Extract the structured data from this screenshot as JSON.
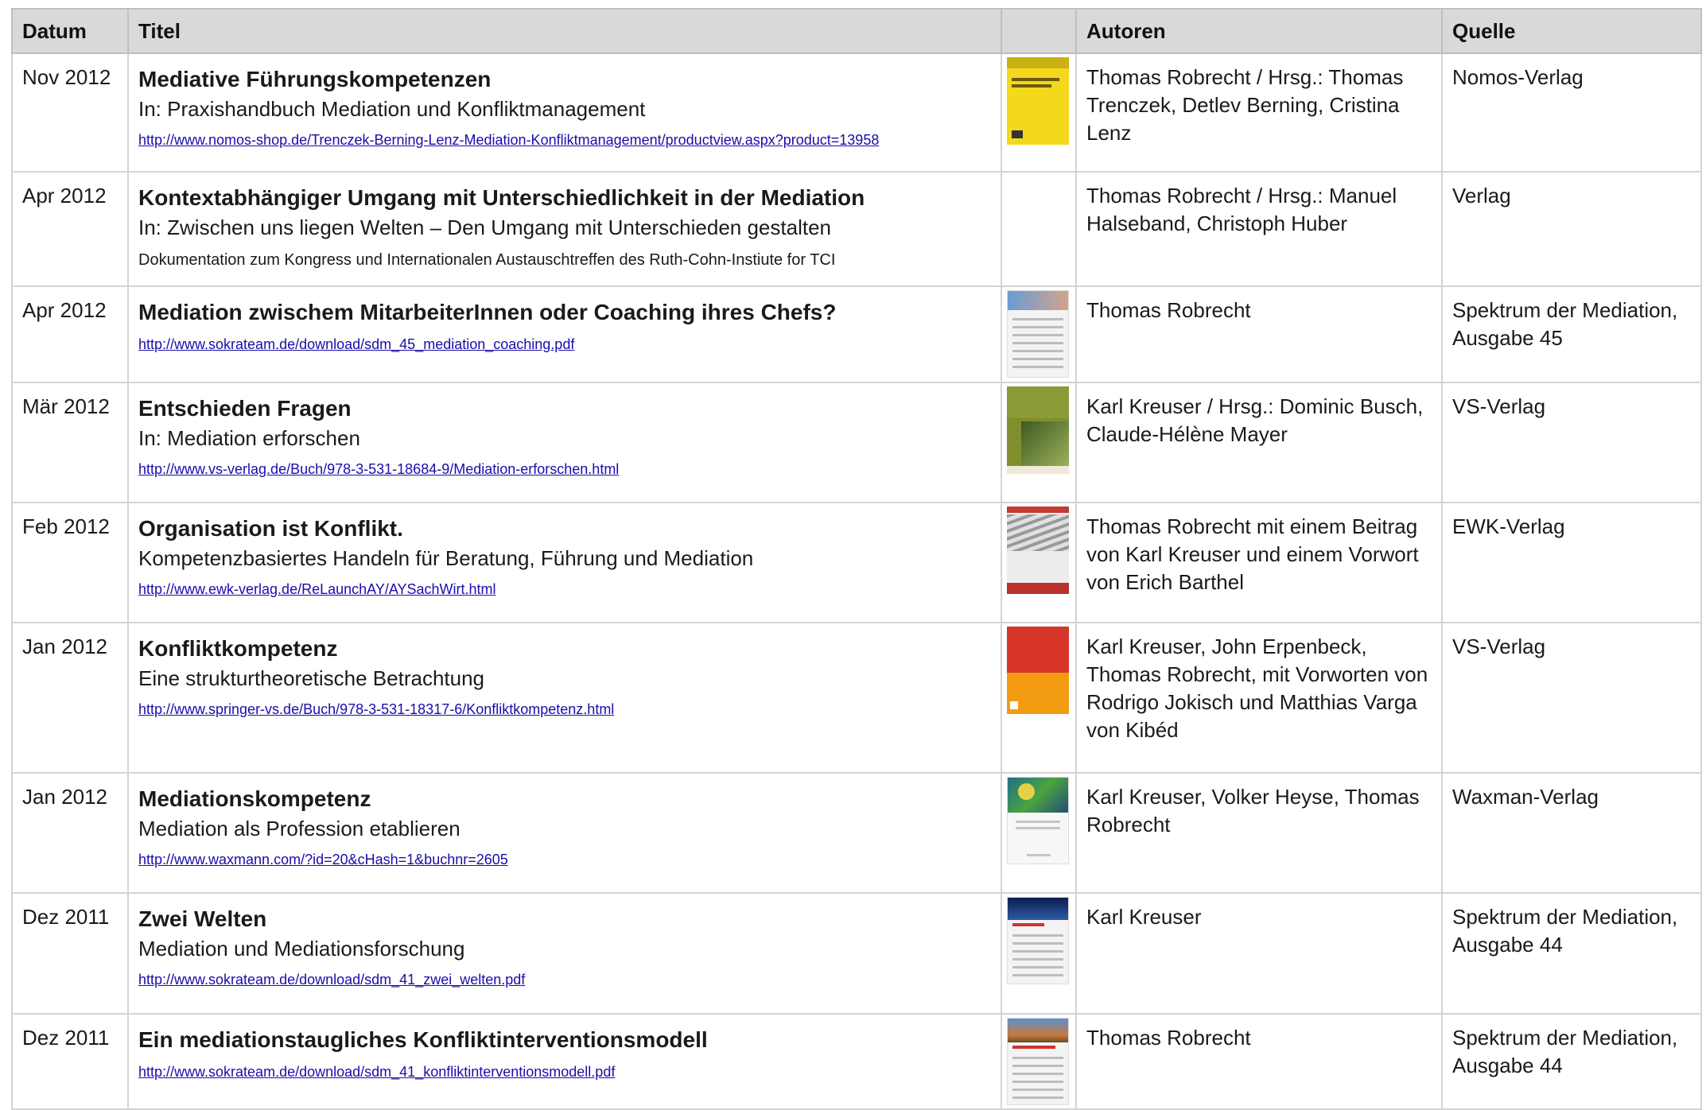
{
  "header": {
    "datum": "Datum",
    "titel": "Titel",
    "autoren": "Autoren",
    "quelle": "Quelle"
  },
  "rows": [
    {
      "date": "Nov 2012",
      "title": "Mediative Führungskompetenzen",
      "subtitle": "In: Praxishandbuch Mediation und Konfliktmanagement",
      "link": "http://www.nomos-shop.de/Trenczek-Berning-Lenz-Mediation-Konfliktmanagement/productview.aspx?product=13958",
      "note": "",
      "cover": "yellow-book-cover",
      "authors": "Thomas Robrecht /  Hrsg.: Thomas Trenczek, Detlev Berning,  Cristina Lenz",
      "source": "Nomos-Verlag"
    },
    {
      "date": "Apr 2012",
      "title": "Kontextabhängiger Umgang mit Unterschiedlichkeit in der Mediation",
      "subtitle": "In: Zwischen uns liegen Welten – Den Umgang mit Unterschieden gestalten",
      "link": "",
      "note": "Dokumentation zum Kongress und Internationalen Austauschtreffen des Ruth-Cohn-Instiute for TCI",
      "cover": "",
      "authors": "Thomas Robrecht / Hrsg.: Manuel Halseband, Christoph Huber",
      "source": "Verlag"
    },
    {
      "date": "Apr 2012",
      "title": "Mediation zwischem MitarbeiterInnen oder Coaching ihres Chefs?",
      "subtitle": "",
      "link": "http://www.sokrateam.de/download/sdm_45_mediation_coaching.pdf",
      "note": "",
      "cover": "magazine-cover",
      "authors": "Thomas Robrecht",
      "source": "Spektrum der Mediation, Ausgabe 45"
    },
    {
      "date": "Mär 2012",
      "title": "Entschieden Fragen",
      "subtitle": "In: Mediation erforschen",
      "link": "http://www.vs-verlag.de/Buch/978-3-531-18684-9/Mediation-erforschen.html",
      "note": "",
      "cover": "green-book-cover",
      "authors": "Karl Kreuser / Hrsg.: Dominic Busch, Claude-Hélène Mayer",
      "source": "VS-Verlag"
    },
    {
      "date": "Feb 2012",
      "title": "Organisation ist Konflikt.",
      "subtitle": "Kompetenzbasiertes Handeln für Beratung, Führung und Mediation",
      "link": "http://www.ewk-verlag.de/ReLaunchAY/AYSachWirt.html",
      "note": "",
      "cover": "architecture-book-cover",
      "authors": "Thomas Robrecht mit einem Beitrag von Karl Kreuser und einem Vorwort von Erich Barthel",
      "source": "EWK-Verlag"
    },
    {
      "date": "Jan 2012",
      "title": "Konfliktkompetenz",
      "subtitle": "Eine strukturtheoretische Betrachtung",
      "link": "http://www.springer-vs.de/Buch/978-3-531-18317-6/Konfliktkompetenz.html",
      "note": "",
      "cover": "red-orange-book-cover",
      "authors": "Karl Kreuser, John Erpenbeck, Thomas Robrecht, mit Vorworten von Rodrigo Jokisch und Matthias Varga von Kibéd",
      "source": "VS-Verlag"
    },
    {
      "date": "Jan 2012",
      "title": "Mediationskompetenz",
      "subtitle": "Mediation als Profession etablieren",
      "link": "http://www.waxmann.com/?id=20&cHash=1&buchnr=2605",
      "note": "",
      "cover": "mosaic-book-cover",
      "authors": "Karl Kreuser, Volker Heyse, Thomas Robrecht",
      "source": "Waxman-Verlag"
    },
    {
      "date": "Dez 2011",
      "title": "Zwei Welten",
      "subtitle": "Mediation und Mediationsforschung",
      "link": "http://www.sokrateam.de/download/sdm_41_zwei_welten.pdf",
      "note": "",
      "cover": "night-magazine-cover",
      "authors": "Karl Kreuser",
      "source": "Spektrum der Mediation, Ausgabe 44"
    },
    {
      "date": "Dez 2011",
      "title": "Ein mediationstaugliches Konfliktinterventionsmodell",
      "subtitle": "",
      "link": "http://www.sokrateam.de/download/sdm_41_konfliktinterventionsmodell.pdf",
      "note": "",
      "cover": "landscape-magazine-cover",
      "authors": "Thomas Robrecht",
      "source": "Spektrum der Mediation, Ausgabe 44"
    }
  ]
}
